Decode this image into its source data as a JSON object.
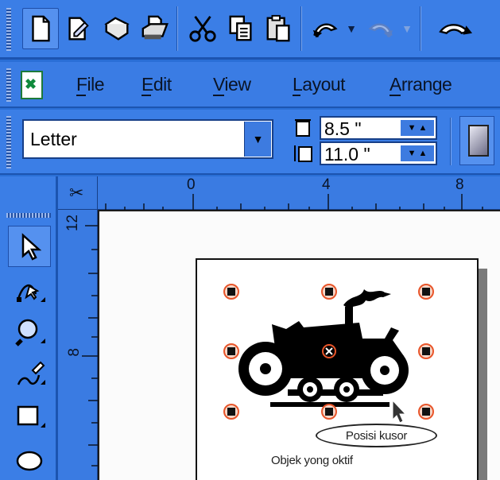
{
  "standard_toolbar": {
    "buttons": [
      {
        "name": "new-document-icon"
      },
      {
        "name": "open-icon"
      },
      {
        "name": "save-icon"
      },
      {
        "name": "print-icon"
      },
      {
        "name": "cut-icon"
      },
      {
        "name": "copy-icon"
      },
      {
        "name": "paste-icon"
      },
      {
        "name": "undo-icon"
      },
      {
        "name": "redo-icon"
      }
    ]
  },
  "menu": {
    "items": [
      {
        "label": "File"
      },
      {
        "label": "Edit"
      },
      {
        "label": "View"
      },
      {
        "label": "Layout"
      },
      {
        "label": "Arrange"
      }
    ]
  },
  "property_bar": {
    "paper_type": "Letter",
    "width": "8.5 \"",
    "height": "11.0 \""
  },
  "toolbox": {
    "tools": [
      "pick-tool",
      "shape-tool",
      "zoom-tool",
      "freehand-tool",
      "rectangle-tool",
      "ellipse-tool"
    ]
  },
  "rulers": {
    "corner": "✂",
    "horizontal_labels": [
      "0",
      "4",
      "8"
    ],
    "vertical_labels": [
      "12",
      "8"
    ]
  },
  "canvas": {
    "cursor_callout": "Posisi kusor",
    "selection_label": "Objek yong oktif"
  },
  "colors": {
    "toolbar_blue": "#3b7ee6",
    "dark_blue": "#1c54b0",
    "handle_ring": "#e8552a"
  }
}
